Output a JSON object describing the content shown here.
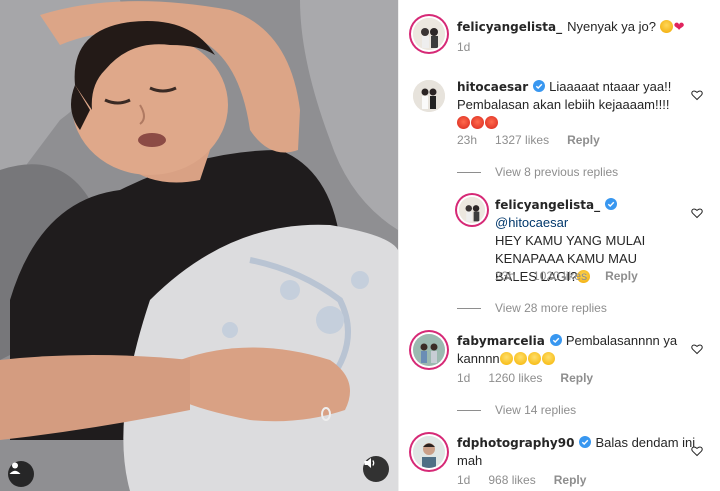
{
  "post": {
    "author": "felicyangelista_",
    "caption": "Nyenyak ya jo?",
    "time": "1d"
  },
  "comments": [
    {
      "username": "hitocaesar",
      "verified": true,
      "text_line1": "Liaaaaat ntaaar yaa!!",
      "text_line2": "Pembalasan akan lebiih kejaaaam!!!!",
      "time": "23h",
      "likes": "1327 likes",
      "reply_label": "Reply",
      "view_replies": "View 8 previous replies",
      "reply": {
        "username": "felicyangelista_",
        "verified": true,
        "mention": "@hitocaesar",
        "text_line1": "HEY KAMU YANG MULAI",
        "text_line2": "KENAPAAA KAMU MAU",
        "text_line3": "BALES LAGI?",
        "time": "23h",
        "likes": "1020 likes",
        "reply_label": "Reply"
      },
      "view_more_replies": "View 28 more replies"
    },
    {
      "username": "fabymarcelia",
      "verified": true,
      "text_line1": "Pembalasannnn ya",
      "text_line2": "kannnn",
      "time": "1d",
      "likes": "1260 likes",
      "reply_label": "Reply",
      "view_replies": "View 14 replies"
    },
    {
      "username": "fdphotography90",
      "verified": true,
      "text_line1": "Balas dendam ini",
      "text_line2": "mah",
      "time": "1d",
      "likes": "968 likes",
      "reply_label": "Reply"
    }
  ],
  "colors": {
    "verified_blue": "#3897f0",
    "meta_gray": "#8e8e8e",
    "text": "#262626",
    "heart_red": "#e0245e"
  },
  "icons": [
    "user-tag-icon",
    "volume-icon",
    "heart-outline-icon",
    "verified-badge-icon"
  ]
}
